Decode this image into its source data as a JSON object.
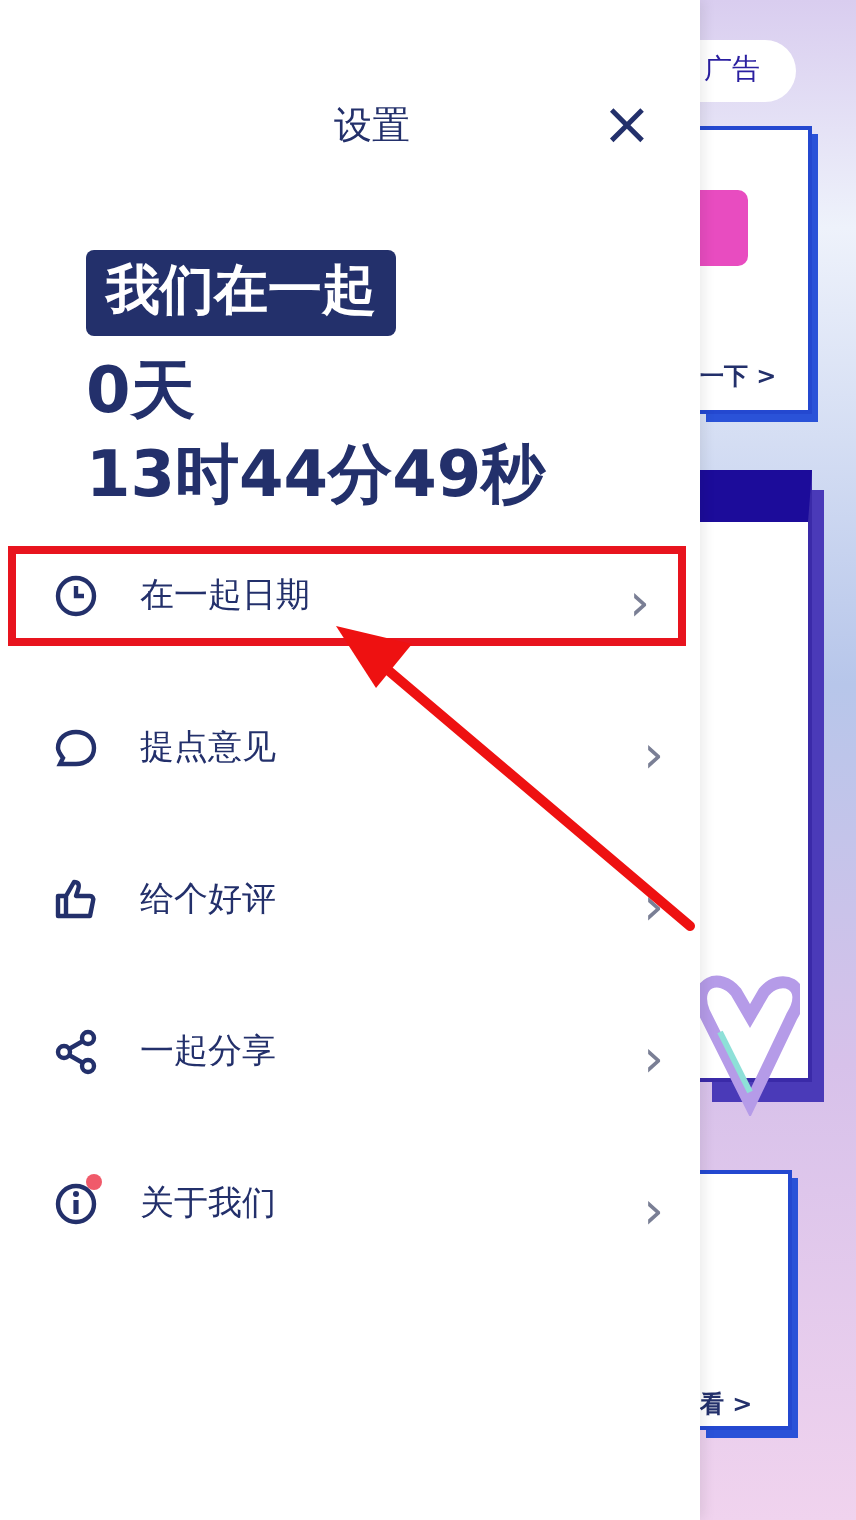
{
  "background": {
    "ad_pill": "广告",
    "card_1_link": "一下 >",
    "card_3_link": "看 >"
  },
  "drawer": {
    "title": "设置",
    "close": "×",
    "badge": "我们在一起",
    "days": "0天",
    "time": "13时44分49秒",
    "items": [
      {
        "kind": "clock",
        "label": "在一起日期",
        "chevron": "›",
        "highlighted": true,
        "dot": false
      },
      {
        "kind": "bubble",
        "label": "提点意见",
        "chevron": "›",
        "highlighted": false,
        "dot": false
      },
      {
        "kind": "thumb",
        "label": "给个好评",
        "chevron": "›",
        "highlighted": false,
        "dot": false
      },
      {
        "kind": "share",
        "label": "一起分享",
        "chevron": "›",
        "highlighted": false,
        "dot": false
      },
      {
        "kind": "info",
        "label": "关于我们",
        "chevron": "›",
        "highlighted": false,
        "dot": true
      }
    ]
  },
  "annotation": {
    "arrow": true
  }
}
